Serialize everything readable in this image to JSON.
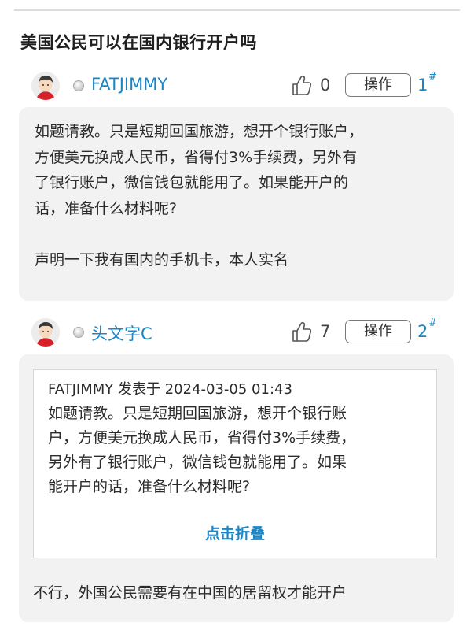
{
  "thread": {
    "title": "美国公民可以在国内银行开户吗"
  },
  "posts": [
    {
      "author": "FATJIMMY",
      "likes": "0",
      "action_label": "操作",
      "floor": "1",
      "floor_suffix": "#",
      "content": "如题请教。只是短期回国旅游，想开个银行账户，\n方便美元换成人民币，省得付3%手续费，另外有\n了银行账户，微信钱包就能用了。如果能开户的\n话，准备什么材料呢?\n\n声明一下我有国内的手机卡，本人实名"
    },
    {
      "author": "头文字C",
      "likes": "7",
      "action_label": "操作",
      "floor": "2",
      "floor_suffix": "#",
      "quote": {
        "meta": "FATJIMMY 发表于 2024-03-05 01:43",
        "content": "如题请教。只是短期回国旅游，想开个银行账\n户，方便美元换成人民币，省得付3%手续费，\n另外有了银行账户，微信钱包就能用了。如果\n能开户的话，准备什么材料呢?",
        "fold_label": "点击折叠"
      },
      "content": "不行，外国公民需要有在中国的居留权才能开户"
    }
  ],
  "icons": {
    "avatar": "avatar-icon",
    "online_status": "offline-status-icon",
    "like": "thumbs-up-icon"
  },
  "colors": {
    "link": "#1a86c7",
    "post_background": "#f2f2f2",
    "quote_border": "#d6d6d6"
  }
}
